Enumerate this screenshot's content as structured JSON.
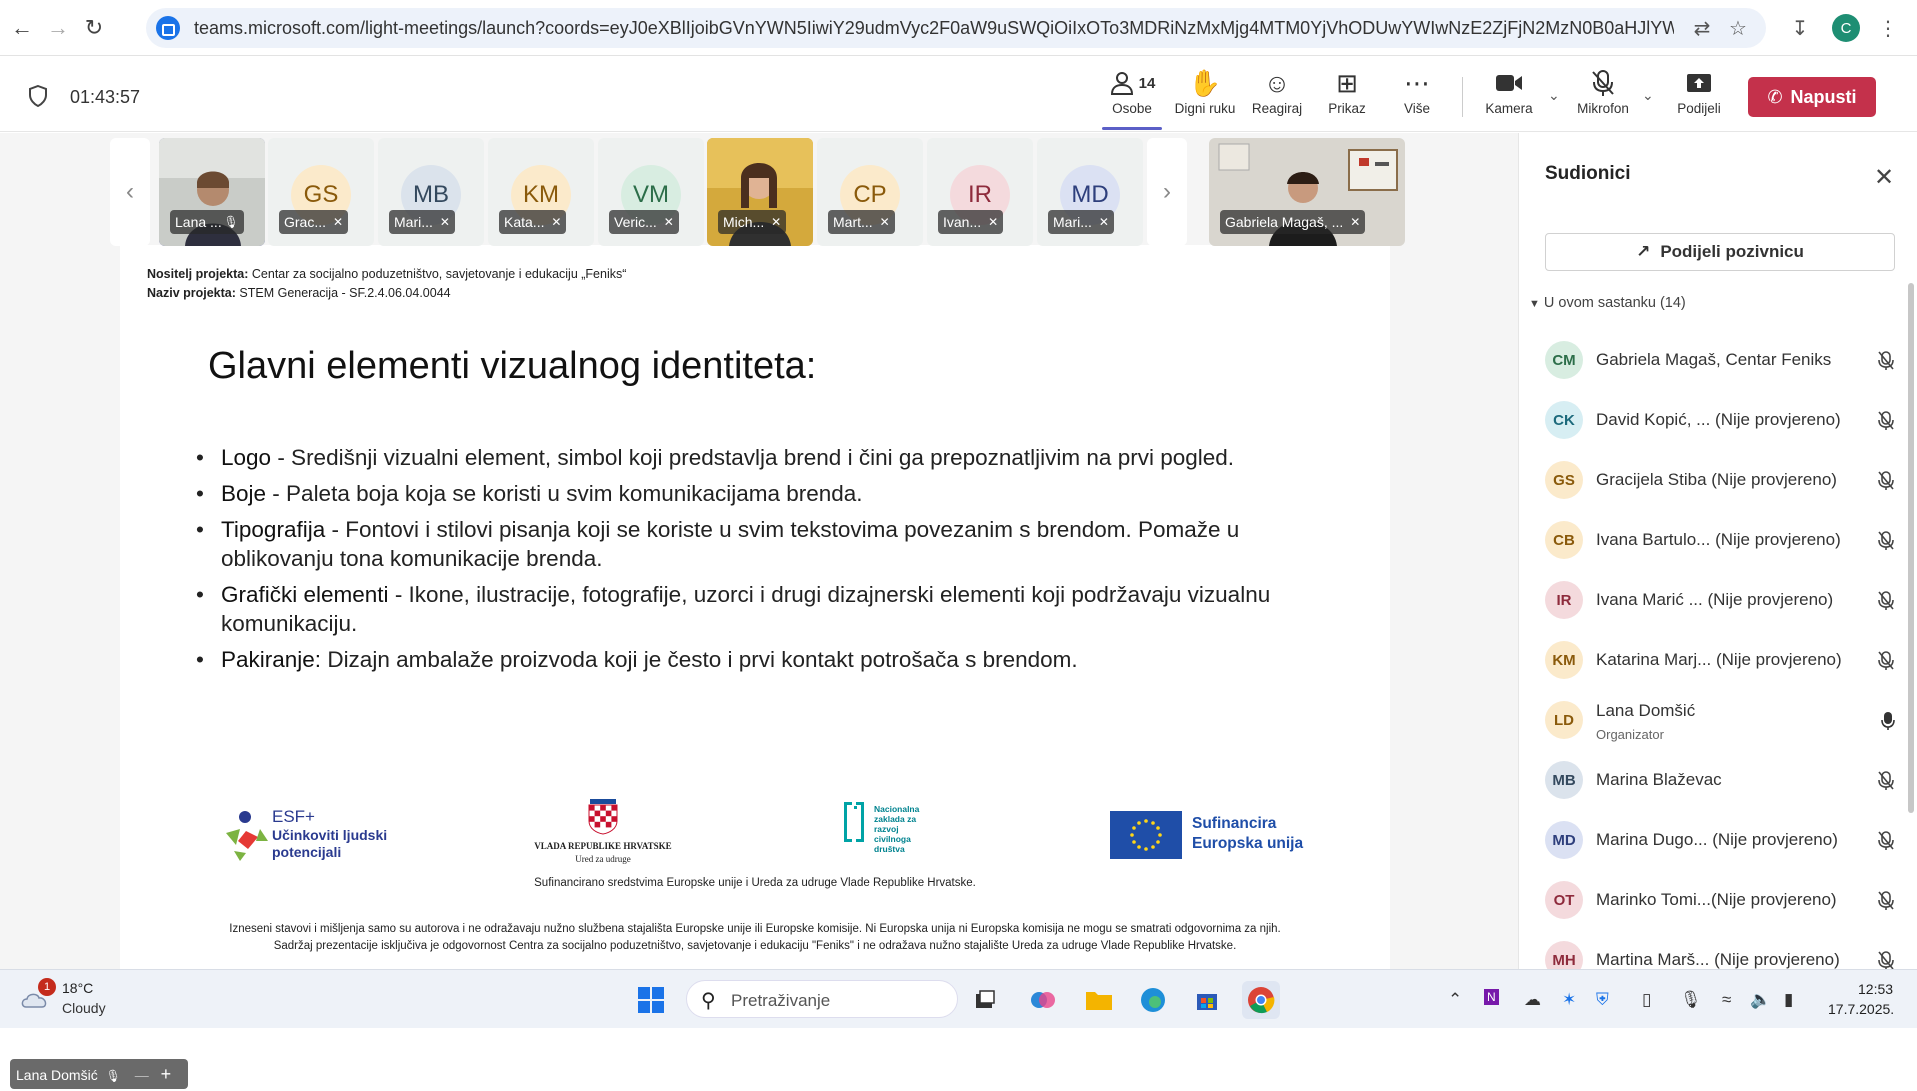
{
  "browser": {
    "url": "teams.microsoft.com/light-meetings/launch?coords=eyJ0eXBlIjoibGVnYWN5IiwiY29udmVyc2F0aW9uSWQiOiIxOTo3MDRiNzMxMjg4MTM0YjVhODUwYWIwNzE2ZjFjN2MzN0B0aHJlYWQudGF",
    "profile_initial": "C"
  },
  "toolbar": {
    "timer": "01:43:57",
    "people_label": "Osobe",
    "people_count": "14",
    "raise_hand_label": "Digni ruku",
    "react_label": "Reagiraj",
    "view_label": "Prikaz",
    "more_label": "Više",
    "camera_label": "Kamera",
    "mic_label": "Mikrofon",
    "share_label": "Podijeli",
    "leave_label": "Napusti"
  },
  "video_strip": {
    "tiles": [
      {
        "name": "Lana ...",
        "initials": "",
        "video": true,
        "active": true
      },
      {
        "name": "Grac...",
        "initials": "GS",
        "bg": "#fbeacb",
        "fg": "#8a5a0b"
      },
      {
        "name": "Mari...",
        "initials": "MB",
        "bg": "#dbe3ec",
        "fg": "#34495e"
      },
      {
        "name": "Kata...",
        "initials": "KM",
        "bg": "#fbeacb",
        "fg": "#8a5a0b"
      },
      {
        "name": "Veric...",
        "initials": "VM",
        "bg": "#d8ede1",
        "fg": "#2c6e49"
      },
      {
        "name": "Mich...",
        "initials": "",
        "video": true
      },
      {
        "name": "Mart...",
        "initials": "CP",
        "bg": "#fbeacb",
        "fg": "#8a5a0b"
      },
      {
        "name": "Ivan...",
        "initials": "IR",
        "bg": "#f4dadd",
        "fg": "#8e2b3c"
      },
      {
        "name": "Mari...",
        "initials": "MD",
        "bg": "#dbe1f3",
        "fg": "#2e3f7c"
      }
    ],
    "pinned": {
      "name": "Gabriela Magaš, ..."
    }
  },
  "slide": {
    "carrier_label": "Nositelj projekta:",
    "carrier_value": " Centar za socijalno poduzetništvo, savjetovanje i edukaciju „Feniks“",
    "project_label": "Naziv projekta:",
    "project_value": " STEM Generacija - SF.2.4.06.04.0044",
    "title": "Glavni elementi vizualnog identiteta:",
    "bullets": [
      {
        "term": "Logo",
        "text": " - Središnji vizualni element, simbol koji predstavlja brend i čini ga prepoznatljivim na prvi pogled."
      },
      {
        "term": "Boje",
        "text": " - Paleta boja koja se koristi u svim komunikacijama brenda."
      },
      {
        "term": "Tipografija",
        "text": " - Fontovi i stilovi pisanja koji se koriste u svim tekstovima povezanim s brendom. Pomaže u oblikovanju tona komunikacije brenda."
      },
      {
        "term": "Grafički elementi",
        "text": " - Ikone, ilustracije, fotografije, uzorci i drugi dizajnerski elementi koji podržavaju vizualnu komunikaciju."
      },
      {
        "term": "Pakiranje:",
        "text": " Dizajn ambalaže proizvoda koji je često i prvi kontakt potrošača s brendom."
      }
    ],
    "logos": {
      "esf_top": "ESF+",
      "esf_line1": "Učinkoviti ljudski",
      "esf_line2": "potencijali",
      "gov_line1": "VLADA REPUBLIKE HRVATSKE",
      "gov_line2": "Ured za udruge",
      "nz_text": "Nacionalna zaklada za razvoj civilnoga društva",
      "eu_line1": "Sufinancira",
      "eu_line2": "Europska unija"
    },
    "funding": "Sufinancirano sredstvima Europske unije i Ureda za udruge Vlade Republike Hrvatske.",
    "disclaimer_1": "Izneseni stavovi i mišljenja samo su autorova i ne odražavaju nužno službena stajališta Europske unije ili Europske komisije. Ni Europska unija ni Europska komisija ne mogu se smatrati odgovornima za njih.",
    "disclaimer_2": "Sadržaj prezentacije isključiva je odgovornost Centra za socijalno poduzetništvo, savjetovanje i edukaciju \"Feniks\" i ne odražava nužno stajalište Ureda za udruge Vlade Republike Hrvatske."
  },
  "self_view_label": "Lana Domšić",
  "panel": {
    "title": "Sudionici",
    "share_invite": "Podijeli pozivnicu",
    "in_meeting": "U ovom sastanku (14)",
    "participants": [
      {
        "initials": "CM",
        "name": "Gabriela Magaš, Centar Feniks",
        "role": "",
        "bg": "#d8ede1",
        "fg": "#2c6e49",
        "mic": "muted"
      },
      {
        "initials": "CK",
        "name": "David Kopić, ...  (Nije provjereno)",
        "role": "",
        "bg": "#d7eef3",
        "fg": "#1d6a7c",
        "mic": "muted"
      },
      {
        "initials": "GS",
        "name": "Gracijela Stiba (Nije provjereno)",
        "role": "",
        "bg": "#fbeacb",
        "fg": "#8a5a0b",
        "mic": "muted"
      },
      {
        "initials": "CB",
        "name": "Ivana Bartulo...  (Nije provjereno)",
        "role": "",
        "bg": "#fbeacb",
        "fg": "#8a5a0b",
        "mic": "muted"
      },
      {
        "initials": "IR",
        "name": "Ivana Marić ...   (Nije provjereno)",
        "role": "",
        "bg": "#f4dadd",
        "fg": "#8e2b3c",
        "mic": "muted"
      },
      {
        "initials": "KM",
        "name": "Katarina Marj...  (Nije provjereno)",
        "role": "",
        "bg": "#fbeacb",
        "fg": "#8a5a0b",
        "mic": "muted"
      },
      {
        "initials": "LD",
        "name": "Lana Domšić",
        "role": "Organizator",
        "bg": "#fbeacb",
        "fg": "#8a5a0b",
        "mic": "on"
      },
      {
        "initials": "MB",
        "name": "Marina Blaževac",
        "role": "",
        "bg": "#dbe3ec",
        "fg": "#34495e",
        "mic": "muted"
      },
      {
        "initials": "MD",
        "name": "Marina Dugo...  (Nije provjereno)",
        "role": "",
        "bg": "#dbe1f3",
        "fg": "#2e3f7c",
        "mic": "muted"
      },
      {
        "initials": "OT",
        "name": "Marinko Tomi...(Nije provjereno)",
        "role": "",
        "bg": "#f4dadd",
        "fg": "#8e2b3c",
        "mic": "muted"
      },
      {
        "initials": "MH",
        "name": "Martina Marš...  (Nije provjereno)",
        "role": "",
        "bg": "#f4dadd",
        "fg": "#8e2b3c",
        "mic": "muted"
      }
    ]
  },
  "taskbar": {
    "weather_badge": "1",
    "temperature": "18°C",
    "condition": "Cloudy",
    "search_placeholder": "Pretraživanje",
    "time": "12:53",
    "date": "17.7.2025."
  }
}
